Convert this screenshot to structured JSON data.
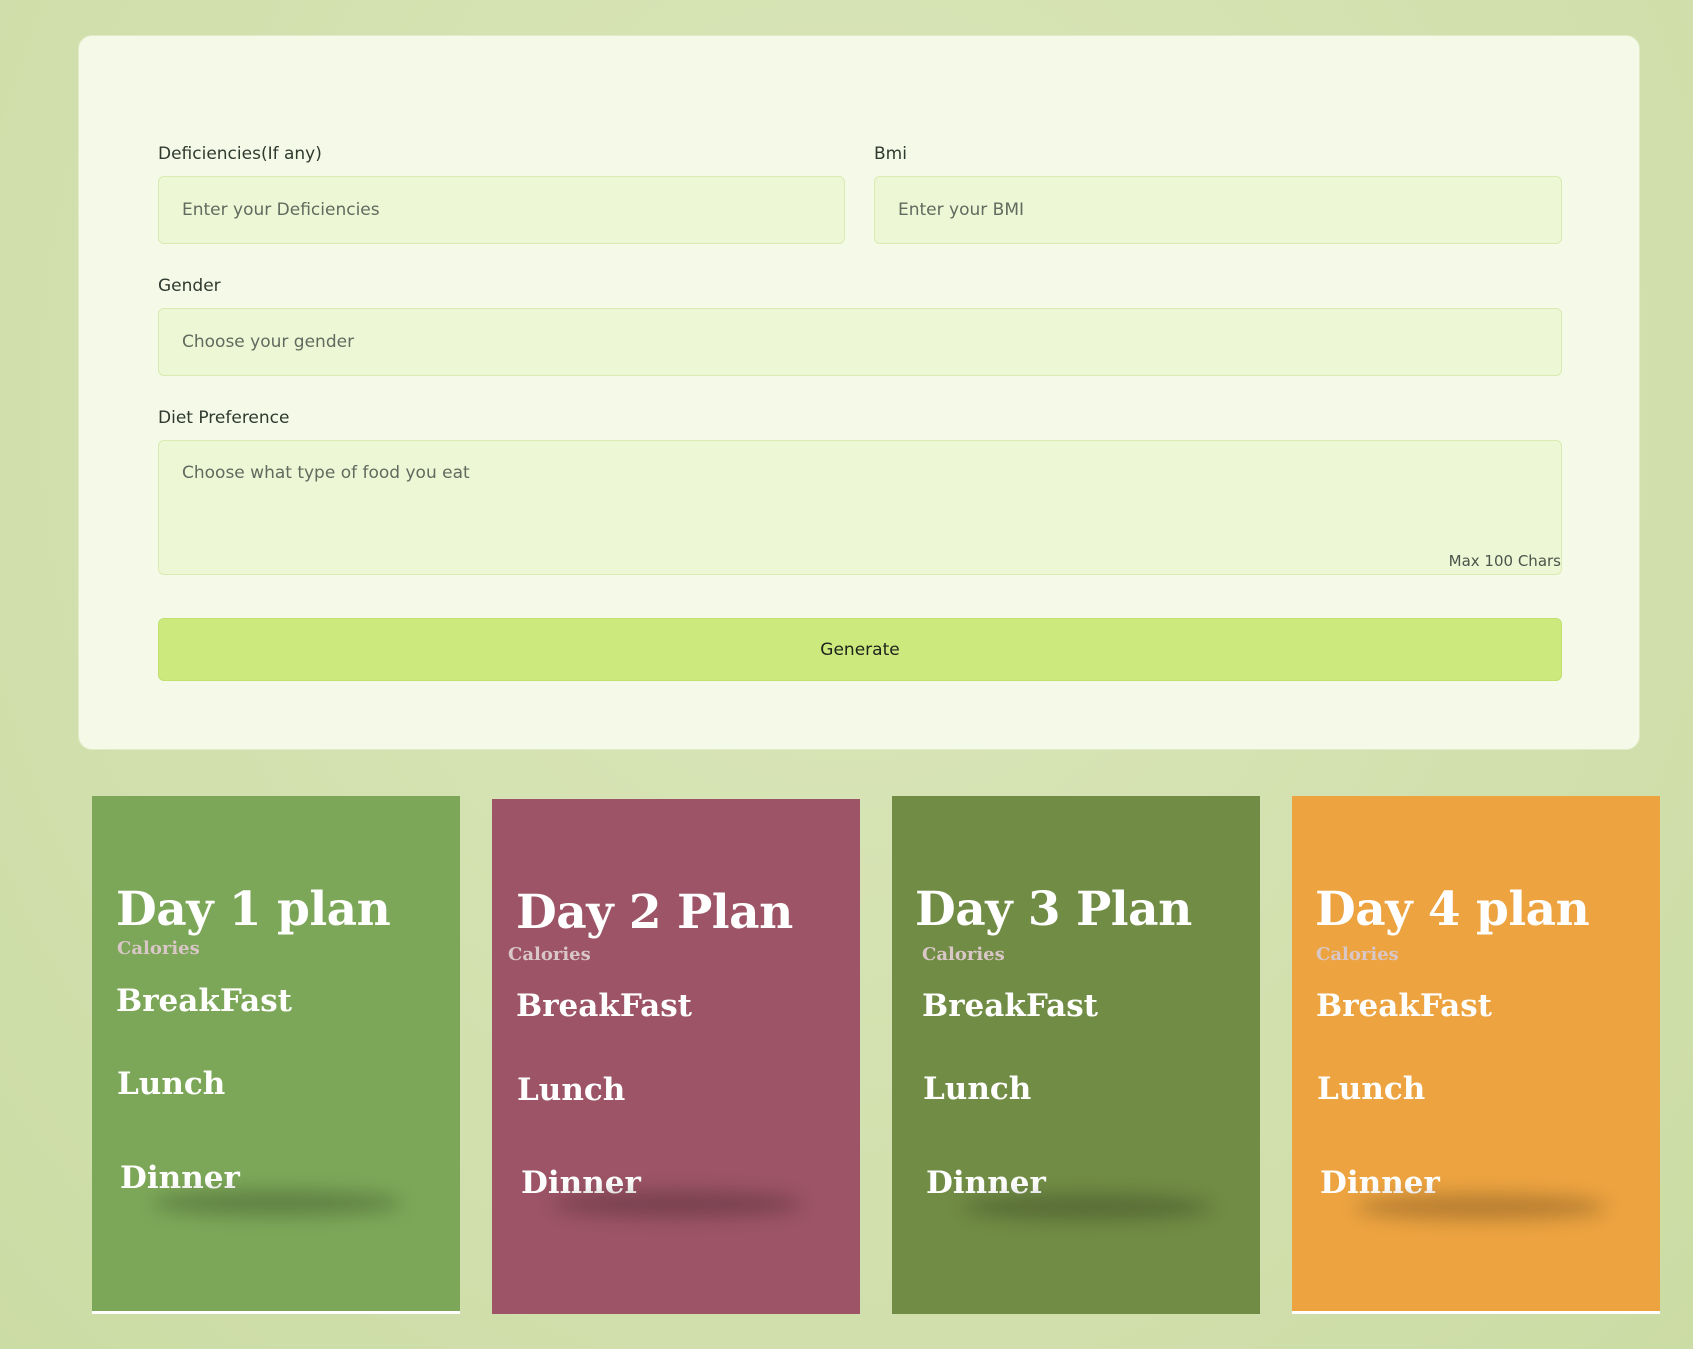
{
  "form": {
    "deficiencies": {
      "label": "Deficiencies(If any)",
      "placeholder": "Enter your Deficiencies"
    },
    "bmi": {
      "label": "Bmi",
      "placeholder": "Enter your BMI"
    },
    "gender": {
      "label": "Gender",
      "placeholder": "Choose your gender"
    },
    "diet_preference": {
      "label": "Diet Preference",
      "placeholder": "Choose what type of food you eat",
      "limit_note": "Max 100 Chars"
    },
    "generate_label": "Generate"
  },
  "plans": [
    {
      "title": "Day 1 plan",
      "calories_label": "Calories",
      "breakfast_label": "BreakFast",
      "lunch_label": "Lunch",
      "dinner_label": "Dinner",
      "color": "#7ca758"
    },
    {
      "title": "Day 2 Plan",
      "calories_label": "Calories",
      "breakfast_label": "BreakFast",
      "lunch_label": "Lunch",
      "dinner_label": "Dinner",
      "color": "#9c5466"
    },
    {
      "title": "Day 3 Plan",
      "calories_label": "Calories",
      "breakfast_label": "BreakFast",
      "lunch_label": "Lunch",
      "dinner_label": "Dinner",
      "color": "#718c45"
    },
    {
      "title": "Day 4 plan",
      "calories_label": "Calories",
      "breakfast_label": "BreakFast",
      "lunch_label": "Lunch",
      "dinner_label": "Dinner",
      "color": "#eca340"
    }
  ]
}
